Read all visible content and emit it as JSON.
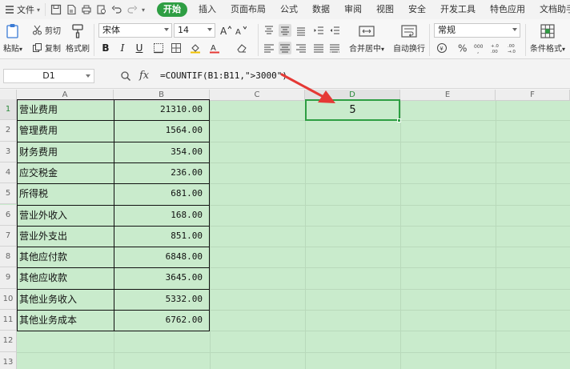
{
  "menu": {
    "file_label": "文件",
    "tabs": [
      "开始",
      "插入",
      "页面布局",
      "公式",
      "数据",
      "审阅",
      "视图",
      "安全",
      "开发工具",
      "特色应用",
      "文档助手"
    ],
    "active_tab": "开始"
  },
  "ribbon": {
    "paste_label": "粘贴",
    "cut_label": "剪切",
    "copy_label": "复制",
    "format_painter_label": "格式刷",
    "font_name": "宋体",
    "font_size": "14",
    "bold_label": "B",
    "italic_label": "I",
    "underline_label": "U",
    "merge_label": "合并居中",
    "wrap_label": "自动换行",
    "number_format": "常规",
    "cond_format_label": "条件格式"
  },
  "formula_bar": {
    "name_box": "D1",
    "fx_label": "fx",
    "formula": "=COUNTIF(B1:B11,\">3000\")"
  },
  "sheet": {
    "columns": [
      "A",
      "B",
      "C",
      "D",
      "E",
      "F"
    ],
    "selected_column": "D",
    "row_numbers": [
      "1",
      "2",
      "3",
      "4",
      "5",
      "6",
      "7",
      "8",
      "9",
      "10",
      "11",
      "12",
      "13"
    ],
    "selected_row": "1",
    "rows": [
      {
        "a": "营业费用",
        "b": "21310.00"
      },
      {
        "a": "管理费用",
        "b": "1564.00"
      },
      {
        "a": "财务费用",
        "b": "354.00"
      },
      {
        "a": "应交税金",
        "b": "236.00"
      },
      {
        "a": "所得税",
        "b": "681.00"
      },
      {
        "a": "营业外收入",
        "b": "168.00"
      },
      {
        "a": "营业外支出",
        "b": "851.00"
      },
      {
        "a": "其他应付款",
        "b": "6848.00"
      },
      {
        "a": "其他应收款",
        "b": "3645.00"
      },
      {
        "a": "其他业务收入",
        "b": "5332.00"
      },
      {
        "a": "其他业务成本",
        "b": "6762.00"
      }
    ],
    "d1_value": "5"
  },
  "colors": {
    "accent": "#2e9e43",
    "sheet_bg": "#c9ebcc",
    "arrow": "#e53935"
  }
}
